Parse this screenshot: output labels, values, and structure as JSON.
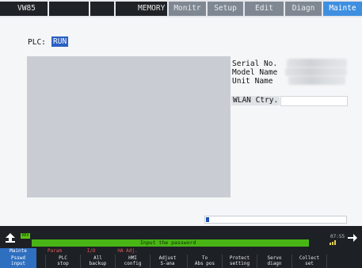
{
  "topbar": {
    "machine": "VW85",
    "mode": "MEMORY",
    "tabs": [
      {
        "label": "Monitr"
      },
      {
        "label": "Setup"
      },
      {
        "label": "Edit"
      },
      {
        "label": "Diagn"
      },
      {
        "label": "Mainte",
        "active": true
      }
    ]
  },
  "plc": {
    "label": "PLC:",
    "value": "RUN"
  },
  "info": {
    "serial_label": "Serial No.",
    "model_label": "Model Name",
    "unit_label": "Unit Name",
    "wlan_label": "WLAN Ctry.",
    "wlan_value": ""
  },
  "progress": {
    "fraction": 0.02
  },
  "status": {
    "rev": "REV",
    "message": "Input the password",
    "time": "07:55"
  },
  "menu": [
    {
      "label": "Mainte",
      "active": true
    },
    {
      "label": "Param"
    },
    {
      "label": "I/O"
    },
    {
      "label": "HA Adj."
    }
  ],
  "function_keys": [
    {
      "line1": "Psswd",
      "line2": "input",
      "active": true
    },
    {
      "line1": "PLC",
      "line2": "stop"
    },
    {
      "line1": "All",
      "line2": "backup"
    },
    {
      "line1": "HMI",
      "line2": "config"
    },
    {
      "line1": "Adjust",
      "line2": "S-ana"
    },
    {
      "line1": "To",
      "line2": "Abs pos"
    },
    {
      "line1": "Protect",
      "line2": "setting"
    },
    {
      "line1": "Servo",
      "line2": "diagn"
    },
    {
      "line1": "Collect",
      "line2": "set"
    },
    {
      "line1": "",
      "line2": ""
    }
  ],
  "colors": {
    "accent": "#3f8fe0",
    "status_green": "#49b515",
    "plc_run": "#2b5fc4"
  }
}
